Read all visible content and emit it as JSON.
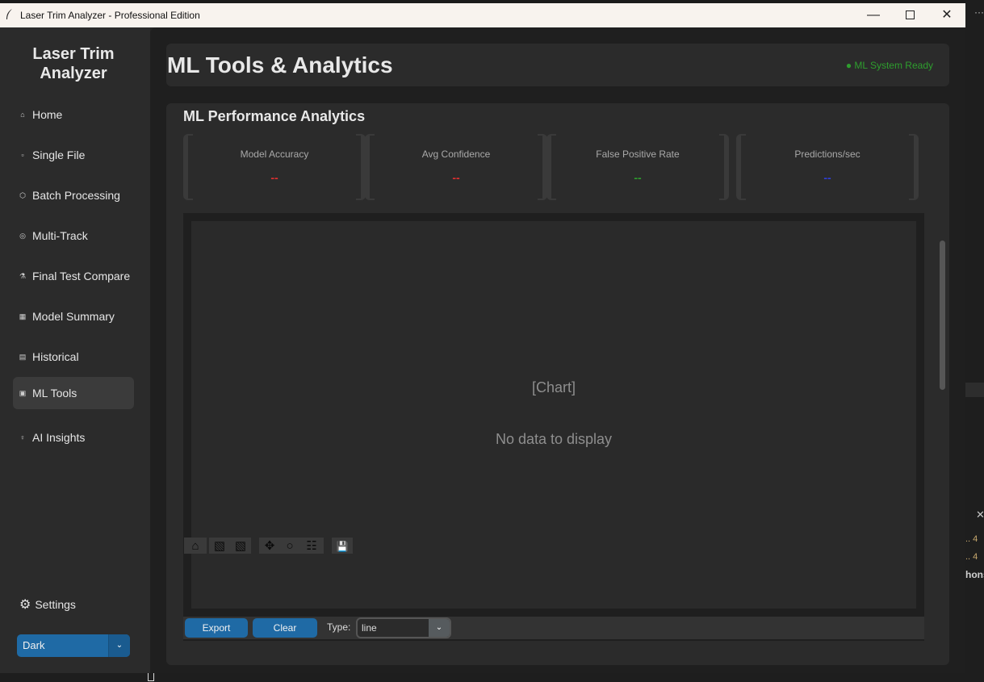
{
  "window": {
    "title": "Laser Trim Analyzer - Professional Edition",
    "controls": {
      "minimize": "—",
      "close": "✕"
    }
  },
  "sidebar": {
    "logo": "Laser Trim\nAnalyzer",
    "items": [
      {
        "label": "Home",
        "icon": "home-icon",
        "glyph": "⌂"
      },
      {
        "label": "Single File",
        "icon": "document-icon",
        "glyph": "▫"
      },
      {
        "label": "Batch Processing",
        "icon": "package-icon",
        "glyph": "⬡"
      },
      {
        "label": "Multi-Track",
        "icon": "target-icon",
        "glyph": "◎"
      },
      {
        "label": "Final Test Compare",
        "icon": "flask-icon",
        "glyph": "⚗"
      },
      {
        "label": "Model Summary",
        "icon": "chart-icon",
        "glyph": "▦"
      },
      {
        "label": "Historical",
        "icon": "scroll-icon",
        "glyph": "▤"
      },
      {
        "label": "ML Tools",
        "icon": "robot-icon",
        "glyph": "▣"
      },
      {
        "label": "AI Insights",
        "icon": "lightbulb-icon",
        "glyph": "♀"
      }
    ],
    "active_item": "ML Tools",
    "settings_label": "Settings",
    "settings_glyph": "⚙",
    "theme_value": "Dark",
    "theme_arrow": "⌄"
  },
  "header": {
    "title": "ML Tools & Analytics",
    "status": "● ML System Ready",
    "status_color": "#2e9e2e"
  },
  "analytics": {
    "title": "ML Performance Analytics",
    "metrics": [
      {
        "label": "Model Accuracy",
        "value": "--",
        "color": "#e03030"
      },
      {
        "label": "Avg Confidence",
        "value": "--",
        "color": "#e03030"
      },
      {
        "label": "False Positive Rate",
        "value": "--",
        "color": "#2e9e2e"
      },
      {
        "label": "Predictions/sec",
        "value": "--",
        "color": "#2f3fd8"
      }
    ]
  },
  "chart": {
    "placeholder": "[Chart]",
    "empty_message": "No data to display",
    "export_label": "Export",
    "clear_label": "Clear",
    "type_label": "Type:",
    "type_value": "line",
    "type_arrow": "⌄"
  },
  "plot_toolbar": {
    "home": "⌂",
    "back": "▧",
    "forward": "▧",
    "pan": "✥",
    "zoom": "○",
    "configure": "☷",
    "save": "💾"
  },
  "background": {
    "dots": "···",
    "x": "✕",
    "line1": "..  4",
    "line2": "..  4",
    "line3": "hons"
  }
}
